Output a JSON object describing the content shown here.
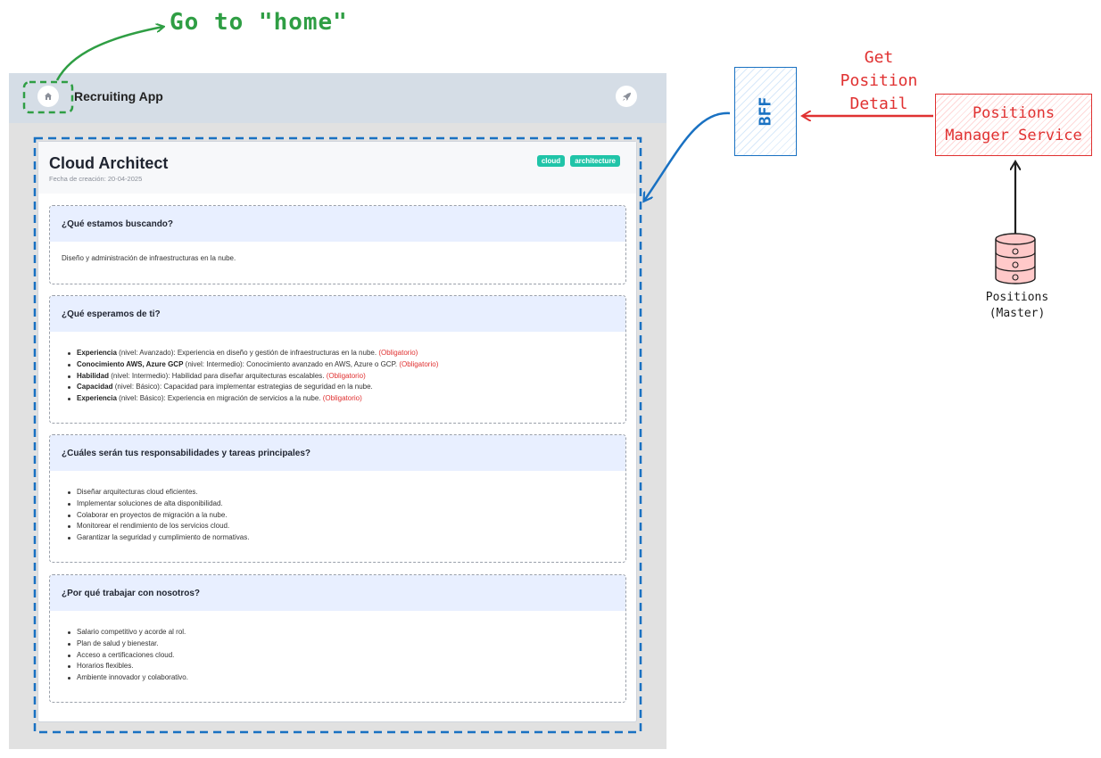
{
  "annotations": {
    "go_home": "Go to \"home\"",
    "get_position_detail": [
      "Get",
      "Position",
      "Detail"
    ],
    "bff_label": "BFF",
    "service_label": [
      "Positions",
      "Manager Service"
    ],
    "database_label": [
      "Positions",
      "(Master)"
    ]
  },
  "colors": {
    "green": "#2f9e44",
    "red": "#e03131",
    "blue": "#1971c2",
    "tag": "#20c4a8"
  },
  "app": {
    "title": "Recruiting App",
    "home_icon": "home-icon",
    "right_icon": "rocket-icon"
  },
  "position": {
    "title": "Cloud Architect",
    "created": "Fecha de creación: 20-04-2025",
    "tags": [
      "cloud",
      "architecture"
    ],
    "sections": [
      {
        "heading": "¿Qué estamos buscando?",
        "text": "Diseño y administración de infraestructuras en la nube."
      },
      {
        "heading": "¿Qué esperamos de ti?",
        "requirements": [
          {
            "name": "Experiencia",
            "detail": "(nivel: Avanzado): Experiencia en diseño y gestión de infraestructuras en la nube.",
            "flag": "(Obligatorio)"
          },
          {
            "name": "Conocimiento AWS, Azure GCP",
            "detail": "(nivel: Intermedio): Conocimiento avanzado en AWS, Azure o GCP.",
            "flag": "(Obligatorio)"
          },
          {
            "name": "Habilidad",
            "detail": "(nivel: Intermedio): Habilidad para diseñar arquitecturas escalables.",
            "flag": "(Obligatorio)"
          },
          {
            "name": "Capacidad",
            "detail": "(nivel: Básico): Capacidad para implementar estrategias de seguridad en la nube.",
            "flag": ""
          },
          {
            "name": "Experiencia",
            "detail": "(nivel: Básico): Experiencia en migración de servicios a la nube.",
            "flag": "(Obligatorio)"
          }
        ]
      },
      {
        "heading": "¿Cuáles serán tus responsabilidades y tareas principales?",
        "items": [
          "Diseñar arquitecturas cloud eficientes.",
          "Implementar soluciones de alta disponibilidad.",
          "Colaborar en proyectos de migración a la nube.",
          "Monitorear el rendimiento de los servicios cloud.",
          "Garantizar la seguridad y cumplimiento de normativas."
        ]
      },
      {
        "heading": "¿Por qué trabajar con nosotros?",
        "items": [
          "Salario competitivo y acorde al rol.",
          "Plan de salud y bienestar.",
          "Acceso a certificaciones cloud.",
          "Horarios flexibles.",
          "Ambiente innovador y colaborativo."
        ]
      }
    ]
  }
}
